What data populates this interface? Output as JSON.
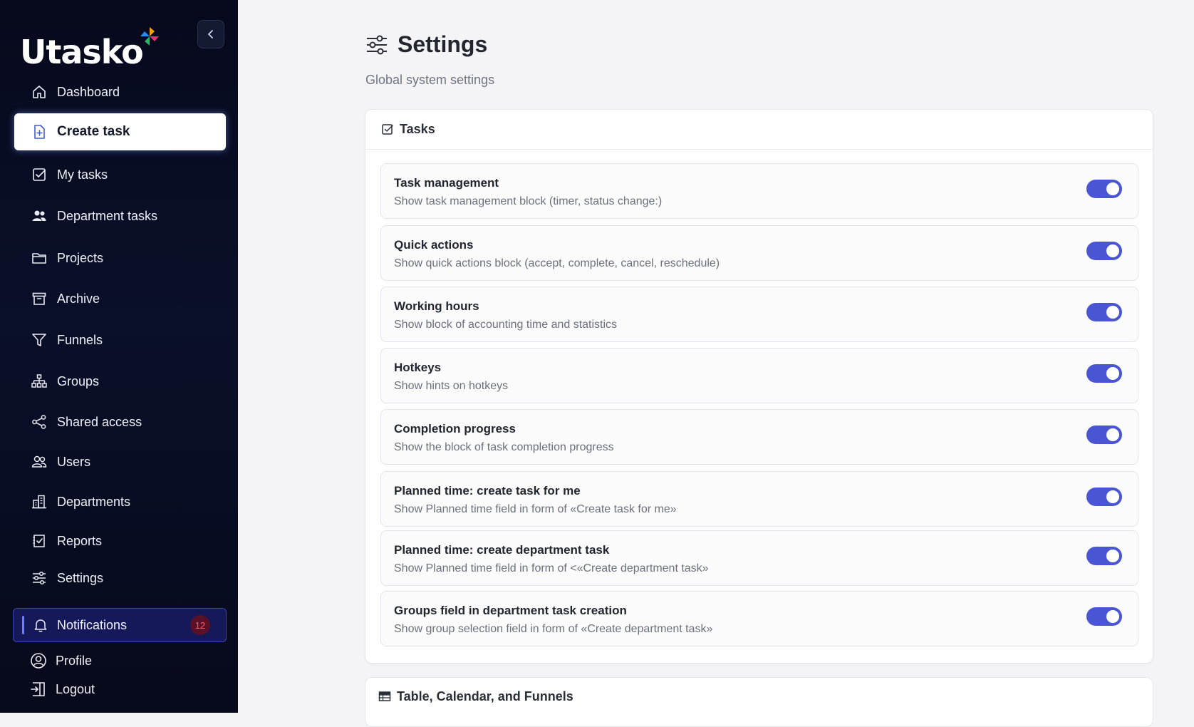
{
  "app": {
    "name": "Utasko"
  },
  "sidebar": {
    "items": [
      {
        "label": "Dashboard",
        "icon": "home-icon"
      },
      {
        "label": "Create task",
        "icon": "file-plus-icon",
        "active": true
      },
      {
        "label": "My tasks",
        "icon": "check-square-icon"
      },
      {
        "label": "Department tasks",
        "icon": "users-solid-icon"
      },
      {
        "label": "Projects",
        "icon": "folder-icon"
      },
      {
        "label": "Archive",
        "icon": "archive-icon"
      },
      {
        "label": "Funnels",
        "icon": "filter-icon"
      },
      {
        "label": "Groups",
        "icon": "hierarchy-icon"
      },
      {
        "label": "Shared access",
        "icon": "share-icon"
      },
      {
        "label": "Users",
        "icon": "users-icon"
      },
      {
        "label": "Departments",
        "icon": "building-icon"
      },
      {
        "label": "Reports",
        "icon": "report-icon"
      },
      {
        "label": "Settings",
        "icon": "sliders-icon"
      }
    ],
    "notifications": {
      "label": "Notifications",
      "count": "12"
    },
    "profile": {
      "label": "Profile"
    },
    "logout": {
      "label": "Logout"
    }
  },
  "page": {
    "title": "Settings",
    "subtitle": "Global system settings"
  },
  "tasks_section": {
    "title": "Tasks",
    "rows": [
      {
        "title": "Task management",
        "desc": "Show task management block (timer, status change:)",
        "enabled": true
      },
      {
        "title": "Quick actions",
        "desc": "Show quick actions block (accept, complete, cancel, reschedule)",
        "enabled": true
      },
      {
        "title": "Working hours",
        "desc": "Show block of accounting time and statistics",
        "enabled": true
      },
      {
        "title": "Hotkeys",
        "desc": "Show hints on hotkeys",
        "enabled": true
      },
      {
        "title": "Completion progress",
        "desc": "Show the block of task completion progress",
        "enabled": true
      },
      {
        "title": "Planned time: create task for me",
        "desc": "Show Planned time field in form of «Create task for me»",
        "enabled": true
      },
      {
        "title": "Planned time: create department task",
        "desc": "Show Planned time field in form of <«Create department task»",
        "enabled": true
      },
      {
        "title": "Groups field in department task creation",
        "desc": "Show group selection field in form of «Create department task»",
        "enabled": true
      }
    ]
  },
  "table_section": {
    "title": "Table, Calendar, and Funnels"
  },
  "colors": {
    "sidebar_bg": "#070a1c",
    "toggle_on": "#4a55d4",
    "badge_text": "#ff5a6e"
  }
}
